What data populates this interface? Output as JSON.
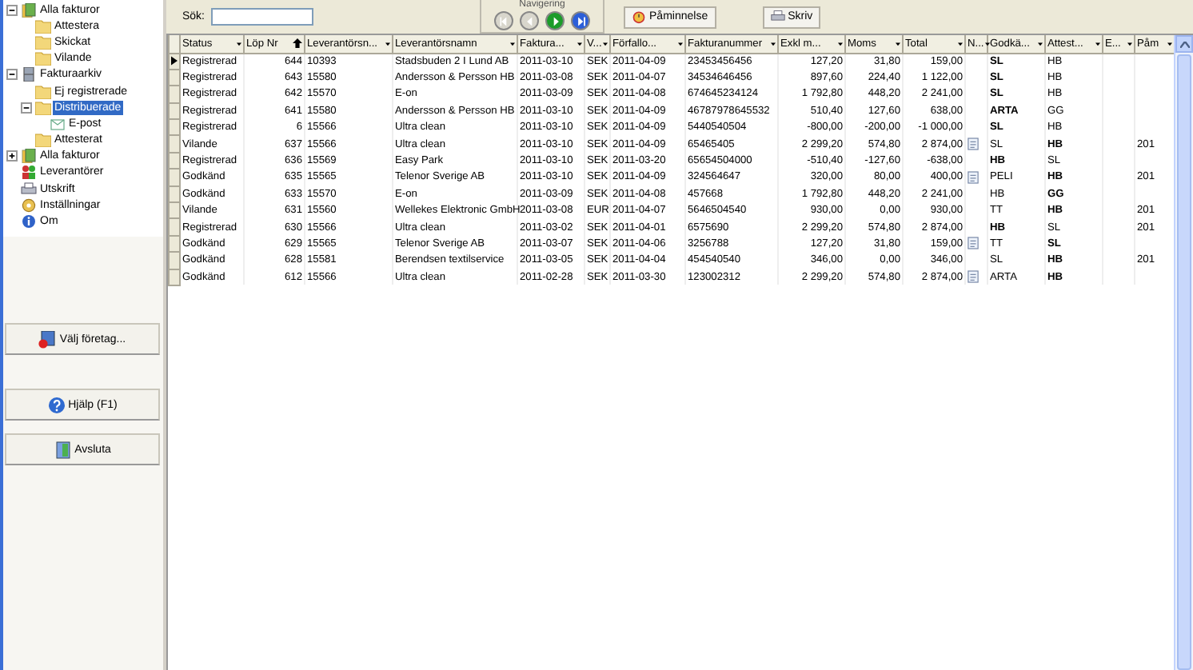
{
  "sidebar": {
    "tree": [
      {
        "label": "Alla fakturor",
        "selected": false,
        "expanded": true,
        "children": [
          {
            "label": "Attestera",
            "selected": false
          },
          {
            "label": "Skickat",
            "selected": false
          },
          {
            "label": "Vilande",
            "selected": false
          }
        ]
      },
      {
        "label": "Fakturaarkiv",
        "selected": false,
        "expanded": true,
        "children": [
          {
            "label": "Ej registrerade",
            "selected": false
          },
          {
            "label": "Distribuerade",
            "selected": true,
            "expanded": true,
            "children": [
              {
                "label": "E-post",
                "selected": false
              }
            ]
          },
          {
            "label": "Attesterat",
            "selected": false
          }
        ]
      },
      {
        "label": "Alla fakturor",
        "selected": false,
        "expanded": false
      },
      {
        "label": "Leverantörer",
        "selected": false
      },
      {
        "label": "Utskrift",
        "selected": false
      },
      {
        "label": "Inställningar",
        "selected": false
      },
      {
        "label": "Om",
        "selected": false
      }
    ],
    "buttons": [
      {
        "label": "Välj företag..."
      },
      {
        "label": "Hjälp (F1)"
      },
      {
        "label": "Avsluta"
      }
    ]
  },
  "toolbar": {
    "search": {
      "label": "Sök:"
    },
    "navigation": {
      "title": "Navigering",
      "buttons": [
        {
          "kind": "first",
          "disabled": true
        },
        {
          "kind": "prev",
          "disabled": true
        },
        {
          "kind": "next",
          "disabled": false
        },
        {
          "kind": "last",
          "disabled": false
        }
      ]
    },
    "buttons": [
      {
        "label": "Påminnelse"
      },
      {
        "label": "Skriv"
      }
    ]
  },
  "table": {
    "columns": [
      {
        "label": "Status",
        "kind": "text",
        "sorted": false
      },
      {
        "label": "Löp Nr",
        "kind": "number",
        "sorted": true
      },
      {
        "label": "Leverantörsn...",
        "kind": "text",
        "sorted": false
      },
      {
        "label": "Leverantörsnamn",
        "kind": "text",
        "sorted": false
      },
      {
        "label": "Faktura...",
        "kind": "text",
        "sorted": false
      },
      {
        "label": "V...",
        "kind": "text",
        "sorted": false
      },
      {
        "label": "Förfallo...",
        "kind": "text",
        "sorted": false
      },
      {
        "label": "Fakturanummer",
        "kind": "text",
        "sorted": false
      },
      {
        "label": "Exkl m...",
        "kind": "number",
        "sorted": false
      },
      {
        "label": "Moms",
        "kind": "number",
        "sorted": false
      },
      {
        "label": "Total",
        "kind": "number",
        "sorted": false
      },
      {
        "label": "N...",
        "kind": "note",
        "sorted": false
      },
      {
        "label": "Godkä...",
        "kind": "text",
        "sorted": false
      },
      {
        "label": "Attest...",
        "kind": "text",
        "sorted": false
      },
      {
        "label": "E...",
        "kind": "text",
        "sorted": false
      },
      {
        "label": "Påm",
        "kind": "text",
        "sorted": false
      }
    ],
    "rows": [
      {
        "current": true,
        "cells": [
          "Registrerad",
          "644",
          "10393",
          "Stadsbuden 2 I Lund AB",
          "2011-03-10",
          "SEK",
          "2011-04-09",
          "23453456456",
          "127,20",
          "31,80",
          "159,00"
        ],
        "note": false,
        "approver": {
          "text": "SL",
          "bold": true
        },
        "attester": {
          "text": "HB",
          "bold": false
        }
      },
      {
        "current": false,
        "cells": [
          "Registrerad",
          "643",
          "15580",
          "Andersson & Persson HB",
          "2011-03-08",
          "SEK",
          "2011-04-07",
          "34534646456",
          "897,60",
          "224,40",
          "1 122,00"
        ],
        "note": false,
        "approver": {
          "text": "SL",
          "bold": true
        },
        "attester": {
          "text": "HB",
          "bold": false
        }
      },
      {
        "current": false,
        "cells": [
          "Registrerad",
          "642",
          "15570",
          "E-on",
          "2011-03-09",
          "SEK",
          "2011-04-08",
          "674645234124",
          "1 792,80",
          "448,20",
          "2 241,00"
        ],
        "note": false,
        "approver": {
          "text": "SL",
          "bold": true
        },
        "attester": {
          "text": "HB",
          "bold": false
        }
      },
      {
        "current": false,
        "cells": [
          "Registrerad",
          "641",
          "15580",
          "Andersson & Persson HB",
          "2011-03-10",
          "SEK",
          "2011-04-09",
          "46787978645532",
          "510,40",
          "127,60",
          "638,00"
        ],
        "note": false,
        "approver": {
          "text": "ARTA",
          "bold": true
        },
        "attester": {
          "text": "GG",
          "bold": false
        }
      },
      {
        "current": false,
        "cells": [
          "Registrerad",
          "6",
          "15566",
          "Ultra clean",
          "2011-03-10",
          "SEK",
          "2011-04-09",
          "5440540504",
          "-800,00",
          "-200,00",
          "-1 000,00"
        ],
        "note": false,
        "approver": {
          "text": "SL",
          "bold": true
        },
        "attester": {
          "text": "HB",
          "bold": false
        }
      },
      {
        "current": false,
        "cells": [
          "Vilande",
          "637",
          "15566",
          "Ultra clean",
          "2011-03-10",
          "SEK",
          "2011-04-09",
          "65465405",
          "2 299,20",
          "574,80",
          "2 874,00"
        ],
        "note": true,
        "approver": {
          "text": "SL",
          "bold": false
        },
        "attester": {
          "text": "HB",
          "bold": true
        },
        "reminder": "201"
      },
      {
        "current": false,
        "cells": [
          "Registrerad",
          "636",
          "15569",
          "Easy Park",
          "2011-03-10",
          "SEK",
          "2011-03-20",
          "65654504000",
          "-510,40",
          "-127,60",
          "-638,00"
        ],
        "note": false,
        "approver": {
          "text": "HB",
          "bold": true
        },
        "attester": {
          "text": "SL",
          "bold": false
        }
      },
      {
        "current": false,
        "cells": [
          "Godkänd",
          "635",
          "15565",
          "Telenor Sverige AB",
          "2011-03-10",
          "SEK",
          "2011-04-09",
          "324564647",
          "320,00",
          "80,00",
          "400,00"
        ],
        "note": true,
        "approver": {
          "text": "PELI",
          "bold": false
        },
        "attester": {
          "text": "HB",
          "bold": true
        },
        "reminder": "201"
      },
      {
        "current": false,
        "cells": [
          "Godkänd",
          "633",
          "15570",
          "E-on",
          "2011-03-09",
          "SEK",
          "2011-04-08",
          "457668",
          "1 792,80",
          "448,20",
          "2 241,00"
        ],
        "note": false,
        "approver": {
          "text": "HB",
          "bold": false
        },
        "attester": {
          "text": "GG",
          "bold": true
        }
      },
      {
        "current": false,
        "cells": [
          "Vilande",
          "631",
          "15560",
          "Wellekes Elektronic GmbH",
          "2011-03-08",
          "EUR",
          "2011-04-07",
          "5646504540",
          "930,00",
          "0,00",
          "930,00"
        ],
        "note": false,
        "approver": {
          "text": "TT",
          "bold": false
        },
        "attester": {
          "text": "HB",
          "bold": true
        },
        "reminder": "201"
      },
      {
        "current": false,
        "cells": [
          "Registrerad",
          "630",
          "15566",
          "Ultra clean",
          "2011-03-02",
          "SEK",
          "2011-04-01",
          "6575690",
          "2 299,20",
          "574,80",
          "2 874,00"
        ],
        "note": false,
        "approver": {
          "text": "HB",
          "bold": true
        },
        "attester": {
          "text": "SL",
          "bold": false
        },
        "reminder": "201"
      },
      {
        "current": false,
        "cells": [
          "Godkänd",
          "629",
          "15565",
          "Telenor Sverige AB",
          "2011-03-07",
          "SEK",
          "2011-04-06",
          "3256788",
          "127,20",
          "31,80",
          "159,00"
        ],
        "note": true,
        "approver": {
          "text": "TT",
          "bold": false
        },
        "attester": {
          "text": "SL",
          "bold": true
        }
      },
      {
        "current": false,
        "cells": [
          "Godkänd",
          "628",
          "15581",
          "Berendsen textilservice",
          "2011-03-05",
          "SEK",
          "2011-04-04",
          "454540540",
          "346,00",
          "0,00",
          "346,00"
        ],
        "note": false,
        "approver": {
          "text": "SL",
          "bold": false
        },
        "attester": {
          "text": "HB",
          "bold": true
        },
        "reminder": "201"
      },
      {
        "current": false,
        "cells": [
          "Godkänd",
          "612",
          "15566",
          "Ultra clean",
          "2011-02-28",
          "SEK",
          "2011-03-30",
          "123002312",
          "2 299,20",
          "574,80",
          "2 874,00"
        ],
        "note": true,
        "approver": {
          "text": "ARTA",
          "bold": false
        },
        "attester": {
          "text": "HB",
          "bold": true
        }
      }
    ]
  }
}
